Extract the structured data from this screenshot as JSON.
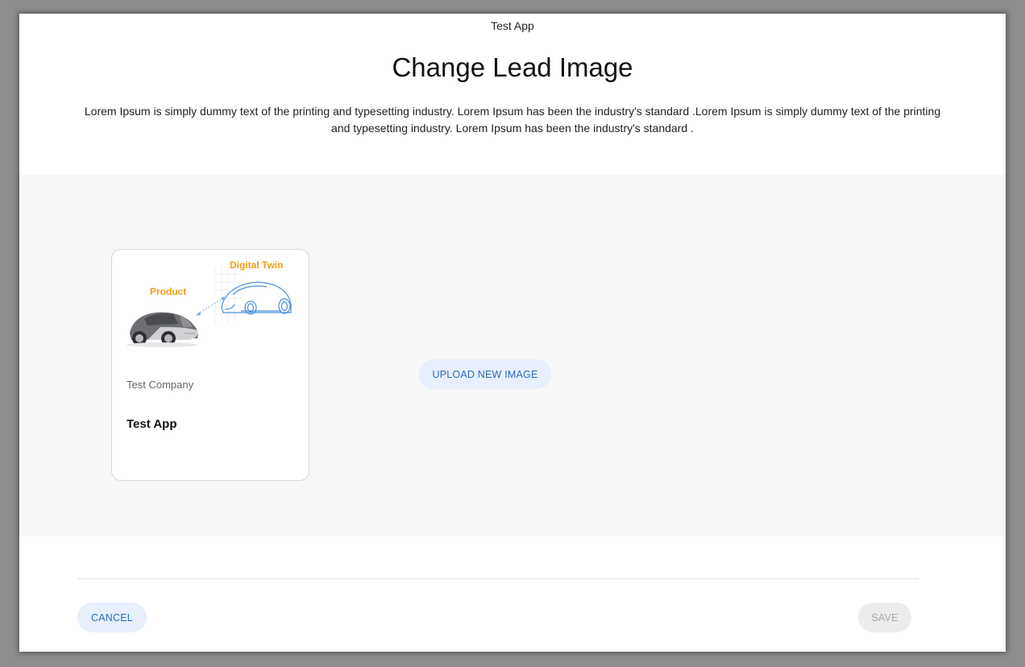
{
  "header": {
    "app_name": "Test App",
    "title": "Change Lead Image",
    "description": "Lorem Ipsum is simply dummy text of the printing and typesetting industry. Lorem Ipsum has been the industry's standard .Lorem Ipsum is simply dummy text of the printing and typesetting industry. Lorem Ipsum has been the industry's standard ."
  },
  "card": {
    "image_labels": {
      "digital_twin": "Digital Twin",
      "product": "Product"
    },
    "company": "Test Company",
    "app_name": "Test App"
  },
  "actions": {
    "upload_label": "UPLOAD NEW IMAGE",
    "cancel_label": "CANCEL",
    "save_label": "SAVE"
  },
  "colors": {
    "accent": "#2b6cc4",
    "accent_bg": "#e6effb",
    "label_orange": "#f29a1a",
    "disabled_bg": "#ececec",
    "disabled_text": "#a8a8a8"
  }
}
